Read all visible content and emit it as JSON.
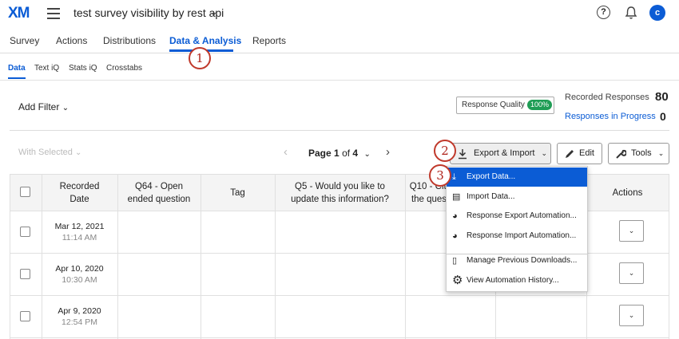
{
  "app": {
    "logo": "XM",
    "survey_title": "test survey visibility by rest api",
    "avatar_initial": "c"
  },
  "main_tabs": [
    "Survey",
    "Actions",
    "Distributions",
    "Data & Analysis",
    "Reports"
  ],
  "active_main_tab": "Data & Analysis",
  "sub_tabs": [
    "Data",
    "Text iQ",
    "Stats iQ",
    "Crosstabs"
  ],
  "active_sub_tab": "Data",
  "filter": {
    "label": "Add Filter"
  },
  "quality": {
    "label": "Response Quality",
    "badge": "100%"
  },
  "stats": {
    "recorded_label": "Recorded Responses",
    "recorded_value": "80",
    "in_progress_label": "Responses in Progress",
    "in_progress_value": "0"
  },
  "toolbar": {
    "with_selected": "With Selected",
    "page_prefix": "Page",
    "page_current": "1",
    "page_of": "of",
    "page_total": "4",
    "export_label": "Export & Import",
    "edit_label": "Edit",
    "tools_label": "Tools"
  },
  "table": {
    "headers": [
      "Recorded Date",
      "Q64 - Open ended question",
      "Tag",
      "Q5 - Would you like to update this information?",
      "Q10 - Citi the ques",
      "Actions"
    ],
    "header_lines": {
      "recorded": [
        "Recorded",
        "Date"
      ],
      "q64": [
        "Q64 - Open",
        "ended question"
      ],
      "tag": [
        "Tag"
      ],
      "q5": [
        "Q5 - Would you like to",
        "update this information?"
      ],
      "q10": [
        "Q10 - Citi",
        "the ques"
      ],
      "actions": [
        "Actions"
      ]
    },
    "rows": [
      {
        "date": "Mar 12, 2021",
        "time": "11:14 AM"
      },
      {
        "date": "Apr 10, 2020",
        "time": "10:30 AM"
      },
      {
        "date": "Apr 9, 2020",
        "time": "12:54 PM"
      }
    ]
  },
  "menu": {
    "items": [
      "Export Data...",
      "Import Data...",
      "Response Export Automation...",
      "Response Import Automation...",
      "Manage Previous Downloads...",
      "View Automation History..."
    ],
    "highlighted": "Export Data..."
  },
  "callouts": [
    "1",
    "2",
    "3"
  ],
  "colors": {
    "accent": "#0b5cd5",
    "callout": "#c0392b",
    "badge": "#1f9d55"
  }
}
